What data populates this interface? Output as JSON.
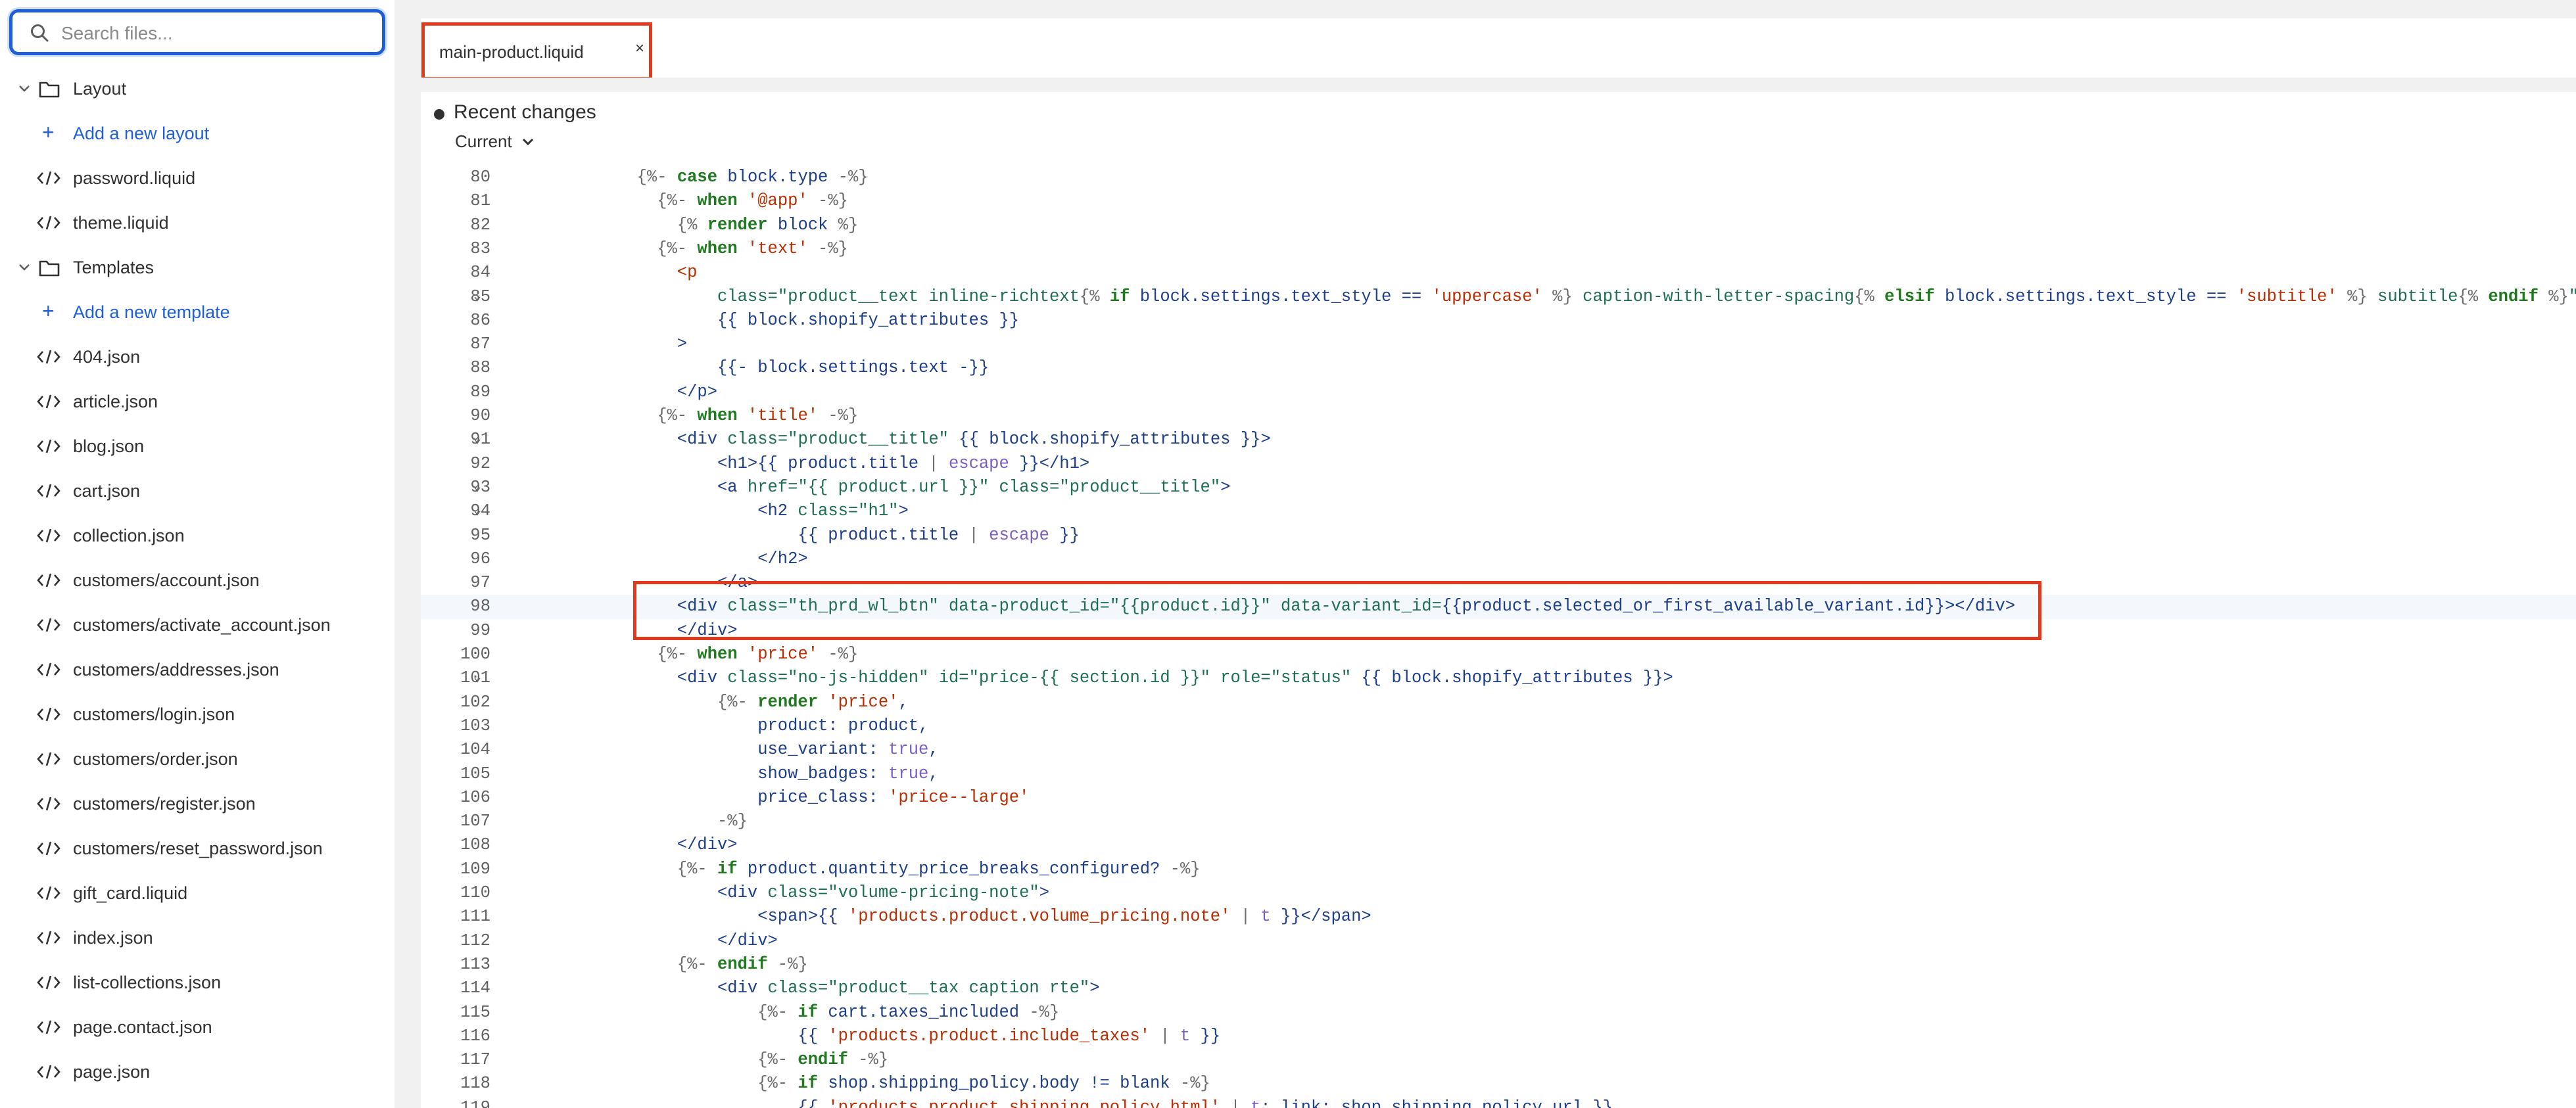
{
  "search": {
    "placeholder": "Search files..."
  },
  "tree": [
    {
      "kind": "folder",
      "label": "Layout"
    },
    {
      "kind": "add",
      "label": "Add a new layout"
    },
    {
      "kind": "file",
      "label": "password.liquid"
    },
    {
      "kind": "file",
      "label": "theme.liquid"
    },
    {
      "kind": "folder",
      "label": "Templates"
    },
    {
      "kind": "add",
      "label": "Add a new template"
    },
    {
      "kind": "file",
      "label": "404.json"
    },
    {
      "kind": "file",
      "label": "article.json"
    },
    {
      "kind": "file",
      "label": "blog.json"
    },
    {
      "kind": "file",
      "label": "cart.json"
    },
    {
      "kind": "file",
      "label": "collection.json"
    },
    {
      "kind": "file",
      "label": "customers/account.json"
    },
    {
      "kind": "file",
      "label": "customers/activate_account.json"
    },
    {
      "kind": "file",
      "label": "customers/addresses.json"
    },
    {
      "kind": "file",
      "label": "customers/login.json"
    },
    {
      "kind": "file",
      "label": "customers/order.json"
    },
    {
      "kind": "file",
      "label": "customers/register.json"
    },
    {
      "kind": "file",
      "label": "customers/reset_password.json"
    },
    {
      "kind": "file",
      "label": "gift_card.liquid"
    },
    {
      "kind": "file",
      "label": "index.json"
    },
    {
      "kind": "file",
      "label": "list-collections.json"
    },
    {
      "kind": "file",
      "label": "page.contact.json"
    },
    {
      "kind": "file",
      "label": "page.json"
    }
  ],
  "tab": {
    "name": "main-product.liquid",
    "close": "×"
  },
  "changes": {
    "title": "Recent changes",
    "selector": "Current"
  },
  "colors": {
    "accent": "#1f5fd6",
    "highlight": "#e0391c"
  },
  "code": [
    {
      "n": "80",
      "i": 6,
      "h": [
        [
          "p",
          "{%- "
        ],
        [
          "k",
          "case"
        ],
        [
          "v",
          " block.type "
        ],
        [
          "p",
          "-%}"
        ]
      ]
    },
    {
      "n": "81",
      "i": 7,
      "h": [
        [
          "p",
          "{%- "
        ],
        [
          "k",
          "when"
        ],
        [
          "s",
          " '@app' "
        ],
        [
          "p",
          "-%}"
        ]
      ]
    },
    {
      "n": "82",
      "i": 8,
      "h": [
        [
          "p",
          "{% "
        ],
        [
          "k",
          "render"
        ],
        [
          "v",
          " block "
        ],
        [
          "p",
          "%}"
        ]
      ]
    },
    {
      "n": "83",
      "i": 7,
      "h": [
        [
          "p",
          "{%- "
        ],
        [
          "k",
          "when"
        ],
        [
          "s",
          " 'text' "
        ],
        [
          "p",
          "-%}"
        ]
      ]
    },
    {
      "n": "84",
      "i": 8,
      "h": [
        [
          "h",
          "<p"
        ]
      ]
    },
    {
      "n": "85",
      "i": 10,
      "f": true,
      "h": [
        [
          "a",
          "class="
        ],
        [
          "s2",
          "\"product__text inline-richtext"
        ],
        [
          "p",
          "{% "
        ],
        [
          "k",
          "if"
        ],
        [
          "v",
          " block.settings.text_style == "
        ],
        [
          "s",
          "'uppercase'"
        ],
        [
          "p",
          " %}"
        ],
        [
          "s2",
          " caption-with-letter-spacing"
        ],
        [
          "p",
          "{% "
        ],
        [
          "k",
          "elsif"
        ],
        [
          "v",
          " block.settings.text_style == "
        ],
        [
          "s",
          "'subtitle'"
        ],
        [
          "p",
          " %}"
        ],
        [
          "s2",
          " subtitle"
        ],
        [
          "p",
          "{% "
        ],
        [
          "k",
          "endif"
        ],
        [
          "p",
          " %}"
        ],
        [
          "s2",
          "\""
        ]
      ]
    },
    {
      "n": "86",
      "i": 10,
      "h": [
        [
          "v",
          "{{ block.shopify_attributes }}"
        ]
      ]
    },
    {
      "n": "87",
      "i": 8,
      "h": [
        [
          "v",
          ">"
        ]
      ]
    },
    {
      "n": "88",
      "i": 10,
      "h": [
        [
          "v",
          "{{- block.settings.text -}}"
        ]
      ]
    },
    {
      "n": "89",
      "i": 8,
      "h": [
        [
          "v",
          "</p>"
        ]
      ]
    },
    {
      "n": "90",
      "i": 7,
      "h": [
        [
          "p",
          "{%- "
        ],
        [
          "k",
          "when"
        ],
        [
          "s",
          " 'title' "
        ],
        [
          "p",
          "-%}"
        ]
      ]
    },
    {
      "n": "91",
      "i": 8,
      "f": true,
      "h": [
        [
          "v",
          "<div "
        ],
        [
          "a",
          "class="
        ],
        [
          "s2",
          "\"product__title\""
        ],
        [
          "v",
          " {{ block.shopify_attributes }}>"
        ]
      ]
    },
    {
      "n": "92",
      "i": 10,
      "h": [
        [
          "v",
          "<h1>{{ product.title "
        ],
        [
          "p",
          "| "
        ],
        [
          "t",
          "escape"
        ],
        [
          "v",
          " }}</h1>"
        ]
      ]
    },
    {
      "n": "93",
      "i": 10,
      "f": true,
      "h": [
        [
          "v",
          "<a "
        ],
        [
          "a",
          "href="
        ],
        [
          "s2",
          "\"{{ product.url }}\""
        ],
        [
          "a",
          " class="
        ],
        [
          "s2",
          "\"product__title\""
        ],
        [
          "v",
          ">"
        ]
      ]
    },
    {
      "n": "94",
      "i": 12,
      "f": true,
      "h": [
        [
          "v",
          "<h2 "
        ],
        [
          "a",
          "class="
        ],
        [
          "s2",
          "\"h1\""
        ],
        [
          "v",
          ">"
        ]
      ]
    },
    {
      "n": "95",
      "i": 14,
      "h": [
        [
          "v",
          "{{ product.title "
        ],
        [
          "p",
          "| "
        ],
        [
          "t",
          "escape"
        ],
        [
          "v",
          " }}"
        ]
      ]
    },
    {
      "n": "96",
      "i": 12,
      "h": [
        [
          "v",
          "</h2>"
        ]
      ]
    },
    {
      "n": "97",
      "i": 10,
      "h": [
        [
          "v",
          "</a>"
        ]
      ]
    },
    {
      "n": "98",
      "i": 8,
      "active": true,
      "h": [
        [
          "v",
          "<div "
        ],
        [
          "a",
          "class="
        ],
        [
          "s2",
          "\"th_prd_wl_btn\""
        ],
        [
          "a",
          " data-product_id="
        ],
        [
          "s2",
          "\"{{product.id}}\""
        ],
        [
          "a",
          " data-variant_id="
        ],
        [
          "v",
          "{{product.selected_or_first_available_variant.id}}></div>"
        ]
      ]
    },
    {
      "n": "99",
      "i": 8,
      "h": [
        [
          "v",
          "</div>"
        ]
      ]
    },
    {
      "n": "100",
      "i": 7,
      "h": [
        [
          "p",
          "{%- "
        ],
        [
          "k",
          "when"
        ],
        [
          "s",
          " 'price' "
        ],
        [
          "p",
          "-%}"
        ]
      ]
    },
    {
      "n": "101",
      "i": 8,
      "f": true,
      "h": [
        [
          "v",
          "<div "
        ],
        [
          "a",
          "class="
        ],
        [
          "s2",
          "\"no-js-hidden\""
        ],
        [
          "a",
          " id="
        ],
        [
          "s2",
          "\"price-{{ section.id }}\""
        ],
        [
          "a",
          " role="
        ],
        [
          "s2",
          "\"status\""
        ],
        [
          "v",
          " {{ block.shopify_attributes }}>"
        ]
      ]
    },
    {
      "n": "102",
      "i": 10,
      "h": [
        [
          "p",
          "{%- "
        ],
        [
          "k",
          "render"
        ],
        [
          "s",
          " 'price'"
        ],
        [
          "v",
          ","
        ]
      ]
    },
    {
      "n": "103",
      "i": 12,
      "h": [
        [
          "v",
          "product: product,"
        ]
      ]
    },
    {
      "n": "104",
      "i": 12,
      "h": [
        [
          "v",
          "use_variant: "
        ],
        [
          "t",
          "true"
        ],
        [
          "v",
          ","
        ]
      ]
    },
    {
      "n": "105",
      "i": 12,
      "h": [
        [
          "v",
          "show_badges: "
        ],
        [
          "t",
          "true"
        ],
        [
          "v",
          ","
        ]
      ]
    },
    {
      "n": "106",
      "i": 12,
      "h": [
        [
          "v",
          "price_class: "
        ],
        [
          "s",
          "'price--large'"
        ]
      ]
    },
    {
      "n": "107",
      "i": 10,
      "h": [
        [
          "p",
          "-%}"
        ]
      ]
    },
    {
      "n": "108",
      "i": 8,
      "h": [
        [
          "v",
          "</div>"
        ]
      ]
    },
    {
      "n": "109",
      "i": 8,
      "h": [
        [
          "p",
          "{%- "
        ],
        [
          "k",
          "if"
        ],
        [
          "v",
          " product.quantity_price_breaks_configured? "
        ],
        [
          "p",
          "-%}"
        ]
      ]
    },
    {
      "n": "110",
      "i": 10,
      "h": [
        [
          "v",
          "<div "
        ],
        [
          "a",
          "class="
        ],
        [
          "s2",
          "\"volume-pricing-note\""
        ],
        [
          "v",
          ">"
        ]
      ]
    },
    {
      "n": "111",
      "i": 12,
      "h": [
        [
          "v",
          "<span>{{ "
        ],
        [
          "s",
          "'products.product.volume_pricing.note'"
        ],
        [
          "p",
          " | "
        ],
        [
          "t",
          "t"
        ],
        [
          "v",
          " }}</span>"
        ]
      ]
    },
    {
      "n": "112",
      "i": 10,
      "h": [
        [
          "v",
          "</div>"
        ]
      ]
    },
    {
      "n": "113",
      "i": 8,
      "h": [
        [
          "p",
          "{%- "
        ],
        [
          "k",
          "endif"
        ],
        [
          "p",
          " -%}"
        ]
      ]
    },
    {
      "n": "114",
      "i": 10,
      "h": [
        [
          "v",
          "<div "
        ],
        [
          "a",
          "class="
        ],
        [
          "s2",
          "\"product__tax caption rte\""
        ],
        [
          "v",
          ">"
        ]
      ]
    },
    {
      "n": "115",
      "i": 12,
      "h": [
        [
          "p",
          "{%- "
        ],
        [
          "k",
          "if"
        ],
        [
          "v",
          " cart.taxes_included "
        ],
        [
          "p",
          "-%}"
        ]
      ]
    },
    {
      "n": "116",
      "i": 14,
      "h": [
        [
          "v",
          "{{ "
        ],
        [
          "s",
          "'products.product.include_taxes'"
        ],
        [
          "p",
          " | "
        ],
        [
          "t",
          "t"
        ],
        [
          "v",
          " }}"
        ]
      ]
    },
    {
      "n": "117",
      "i": 12,
      "h": [
        [
          "p",
          "{%- "
        ],
        [
          "k",
          "endif"
        ],
        [
          "p",
          " -%}"
        ]
      ]
    },
    {
      "n": "118",
      "i": 12,
      "h": [
        [
          "p",
          "{%- "
        ],
        [
          "k",
          "if"
        ],
        [
          "v",
          " shop.shipping_policy.body != blank "
        ],
        [
          "p",
          "-%}"
        ]
      ]
    },
    {
      "n": "119",
      "i": 14,
      "h": [
        [
          "v",
          "{{ "
        ],
        [
          "s",
          "'products.product.shipping_policy_html'"
        ],
        [
          "p",
          " | "
        ],
        [
          "t",
          "t"
        ],
        [
          "v",
          ": link: shop.shipping_policy.url }}"
        ]
      ]
    }
  ]
}
